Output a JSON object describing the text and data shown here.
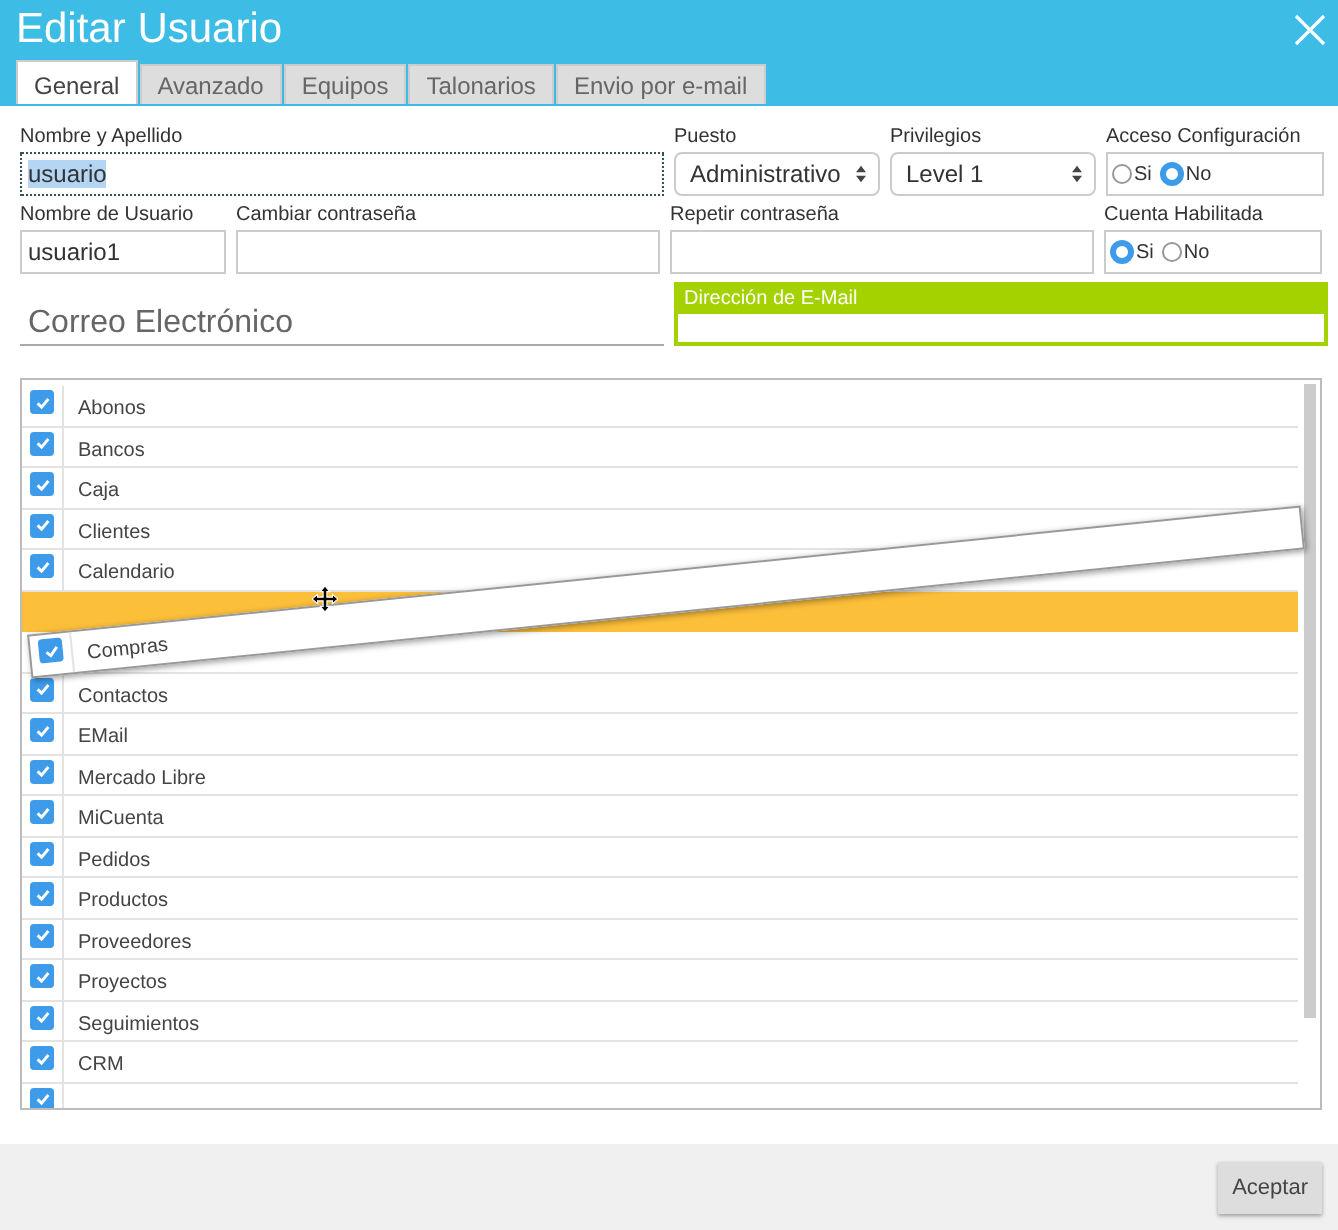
{
  "window": {
    "title": "Editar Usuario"
  },
  "tabs": [
    {
      "label": "General",
      "selected": true
    },
    {
      "label": "Avanzado",
      "selected": false
    },
    {
      "label": "Equipos",
      "selected": false
    },
    {
      "label": "Talonarios",
      "selected": false
    },
    {
      "label": "Envio por e-mail",
      "selected": false
    }
  ],
  "form": {
    "nombre": {
      "label": "Nombre y Apellido",
      "value": "usuario"
    },
    "puesto": {
      "label": "Puesto",
      "value": "Administrativo"
    },
    "privilegios": {
      "label": "Privilegios",
      "value": "Level 1"
    },
    "acceso": {
      "label": "Acceso Configuración",
      "options": [
        {
          "label": "Si",
          "selected": false
        },
        {
          "label": "No",
          "selected": true
        }
      ]
    },
    "usuario": {
      "label": "Nombre de Usuario",
      "value": "usuario1"
    },
    "cambiar": {
      "label": "Cambiar contraseña"
    },
    "repetir": {
      "label": "Repetir contraseña"
    },
    "habilitada": {
      "label": "Cuenta Habilitada",
      "options": [
        {
          "label": "Si",
          "selected": true
        },
        {
          "label": "No",
          "selected": false
        }
      ]
    }
  },
  "email_section": {
    "heading": "Correo Electrónico",
    "field_label": "Dirección de E-Mail"
  },
  "modules": [
    {
      "kind": "item",
      "label": "Abonos",
      "checked": true
    },
    {
      "kind": "item",
      "label": "Bancos",
      "checked": true
    },
    {
      "kind": "item",
      "label": "Caja",
      "checked": true
    },
    {
      "kind": "item",
      "label": "Clientes",
      "checked": true
    },
    {
      "kind": "item",
      "label": "Calendario",
      "checked": true
    },
    {
      "kind": "placeholder"
    },
    {
      "kind": "covered"
    },
    {
      "kind": "item",
      "label": "Contactos",
      "checked": true
    },
    {
      "kind": "item",
      "label": "EMail",
      "checked": true
    },
    {
      "kind": "item",
      "label": "Mercado Libre",
      "checked": true
    },
    {
      "kind": "item",
      "label": "MiCuenta",
      "checked": true
    },
    {
      "kind": "item",
      "label": "Pedidos",
      "checked": true
    },
    {
      "kind": "item",
      "label": "Productos",
      "checked": true
    },
    {
      "kind": "item",
      "label": "Proveedores",
      "checked": true
    },
    {
      "kind": "item",
      "label": "Proyectos",
      "checked": true
    },
    {
      "kind": "item",
      "label": "Seguimientos",
      "checked": true
    },
    {
      "kind": "item",
      "label": "CRM",
      "checked": true
    },
    {
      "kind": "covered",
      "checked": true
    }
  ],
  "dragged_item": {
    "label": "Compras",
    "checked": true
  },
  "buttons": [
    {
      "label": "Aceptar"
    }
  ]
}
